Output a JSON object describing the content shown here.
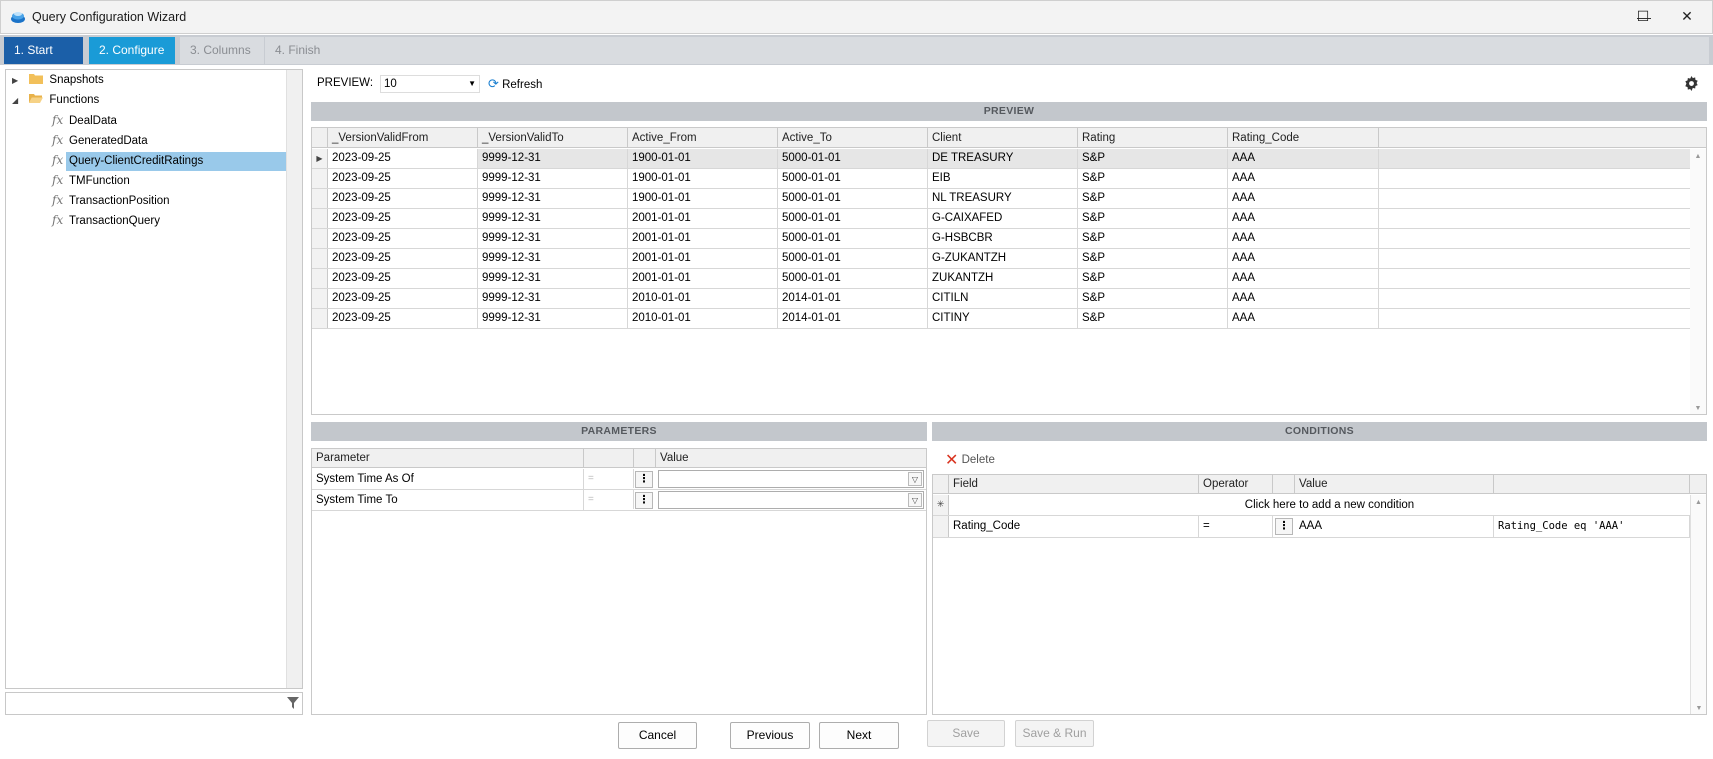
{
  "window": {
    "title": "Query Configuration Wizard",
    "minimize": "—",
    "maximize": "☐",
    "close": "✕"
  },
  "steps": [
    {
      "label": "1. Start",
      "state": "done"
    },
    {
      "label": "2. Configure",
      "state": "active"
    },
    {
      "label": "3. Columns",
      "state": "inactive"
    },
    {
      "label": "4. Finish",
      "state": "inactive"
    }
  ],
  "tree": {
    "folders": [
      {
        "label": "Snapshots",
        "expanded": false
      },
      {
        "label": "Functions",
        "expanded": true
      }
    ],
    "functions": [
      "DealData",
      "GeneratedData",
      "Query-ClientCreditRatings",
      "TMFunction",
      "TransactionPosition",
      "TransactionQuery"
    ],
    "selected": "Query-ClientCreditRatings"
  },
  "filter": {
    "value": ""
  },
  "preview_toolbar": {
    "label": "PREVIEW:",
    "rows_value": "10",
    "refresh_label": "Refresh"
  },
  "preview": {
    "header": "PREVIEW",
    "columns": [
      "_VersionValidFrom",
      "_VersionValidTo",
      "Active_From",
      "Active_To",
      "Client",
      "Rating",
      "Rating_Code"
    ],
    "rows": [
      [
        "2023-09-25",
        "9999-12-31",
        "1900-01-01",
        "5000-01-01",
        "DE TREASURY",
        "S&P",
        "AAA"
      ],
      [
        "2023-09-25",
        "9999-12-31",
        "1900-01-01",
        "5000-01-01",
        "EIB",
        "S&P",
        "AAA"
      ],
      [
        "2023-09-25",
        "9999-12-31",
        "1900-01-01",
        "5000-01-01",
        "NL TREASURY",
        "S&P",
        "AAA"
      ],
      [
        "2023-09-25",
        "9999-12-31",
        "2001-01-01",
        "5000-01-01",
        "G-CAIXAFED",
        "S&P",
        "AAA"
      ],
      [
        "2023-09-25",
        "9999-12-31",
        "2001-01-01",
        "5000-01-01",
        "G-HSBCBR",
        "S&P",
        "AAA"
      ],
      [
        "2023-09-25",
        "9999-12-31",
        "2001-01-01",
        "5000-01-01",
        "G-ZUKANTZH",
        "S&P",
        "AAA"
      ],
      [
        "2023-09-25",
        "9999-12-31",
        "2001-01-01",
        "5000-01-01",
        "ZUKANTZH",
        "S&P",
        "AAA"
      ],
      [
        "2023-09-25",
        "9999-12-31",
        "2010-01-01",
        "2014-01-01",
        "CITILN",
        "S&P",
        "AAA"
      ],
      [
        "2023-09-25",
        "9999-12-31",
        "2010-01-01",
        "2014-01-01",
        "CITINY",
        "S&P",
        "AAA"
      ]
    ]
  },
  "parameters": {
    "header": "PARAMETERS",
    "col_parameter": "Parameter",
    "col_value": "Value",
    "rows": [
      {
        "name": "System Time As Of",
        "op": "=",
        "value": ""
      },
      {
        "name": "System Time To",
        "op": "=",
        "value": ""
      }
    ]
  },
  "conditions": {
    "header": "CONDITIONS",
    "delete_label": "Delete",
    "col_field": "Field",
    "col_operator": "Operator",
    "col_value": "Value",
    "add_prompt": "Click here to add a new condition",
    "rows": [
      {
        "field": "Rating_Code",
        "operator": "=",
        "value": "AAA",
        "expression": "Rating_Code eq 'AAA'"
      }
    ]
  },
  "buttons": {
    "cancel": "Cancel",
    "previous": "Previous",
    "next": "Next",
    "save": "Save",
    "save_run": "Save & Run"
  },
  "colors": {
    "step_done": "#1b5fa8",
    "step_active": "#1a9bd7",
    "selection": "#99c9ea",
    "delete_icon": "#d9331f"
  }
}
